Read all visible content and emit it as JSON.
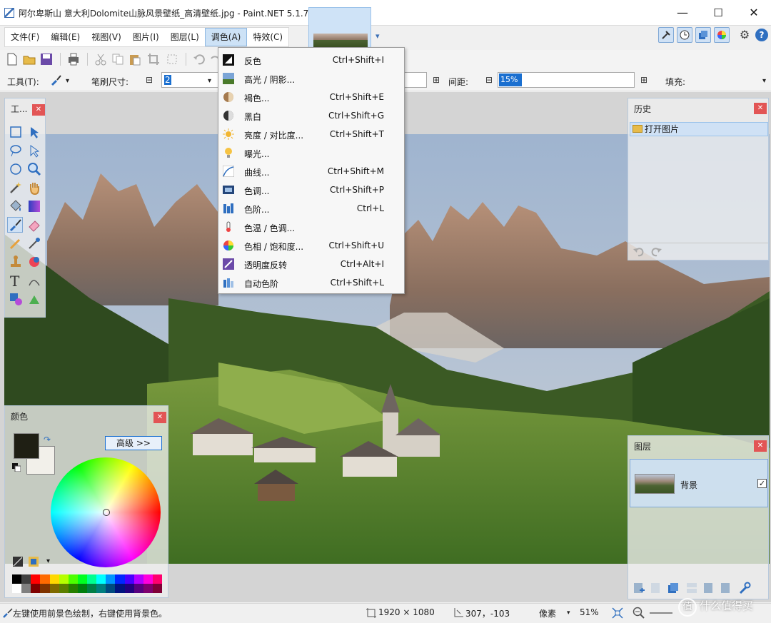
{
  "window": {
    "title": "阿尔卑斯山 意大利Dolomite山脉风景壁纸_高清壁纸.jpg - Paint.NET 5.1.7",
    "controls": {
      "minimize": "—",
      "maximize": "☐",
      "close": "✕"
    }
  },
  "menubar": {
    "items": [
      "文件(F)",
      "编辑(E)",
      "视图(V)",
      "图片(I)",
      "图层(L)",
      "调色(A)",
      "特效(C)"
    ],
    "active_index": 5
  },
  "tool_options": {
    "tool_label": "工具(T):",
    "brush_size_label": "笔刷尺寸:",
    "brush_size_value": "2",
    "gap_label": "间距:",
    "gap_value": "15%",
    "fill_label": "填充:"
  },
  "adjustments_menu": {
    "items": [
      {
        "label": "反色",
        "shortcut": "Ctrl+Shift+I",
        "icon": "invert-colors-icon"
      },
      {
        "label": "高光 / 阴影...",
        "shortcut": "",
        "icon": "highlights-shadows-icon"
      },
      {
        "label": "褐色...",
        "shortcut": "Ctrl+Shift+E",
        "icon": "sepia-icon"
      },
      {
        "label": "黑白",
        "shortcut": "Ctrl+Shift+G",
        "icon": "black-white-icon"
      },
      {
        "label": "亮度 / 对比度...",
        "shortcut": "Ctrl+Shift+T",
        "icon": "brightness-contrast-icon"
      },
      {
        "label": "曝光...",
        "shortcut": "",
        "icon": "exposure-icon"
      },
      {
        "label": "曲线...",
        "shortcut": "Ctrl+Shift+M",
        "icon": "curves-icon"
      },
      {
        "label": "色调...",
        "shortcut": "Ctrl+Shift+P",
        "icon": "posterize-icon"
      },
      {
        "label": "色阶...",
        "shortcut": "Ctrl+L",
        "icon": "levels-icon"
      },
      {
        "label": "色温 / 色调...",
        "shortcut": "",
        "icon": "temperature-icon"
      },
      {
        "label": "色相 / 饱和度...",
        "shortcut": "Ctrl+Shift+U",
        "icon": "hue-saturation-icon"
      },
      {
        "label": "透明度反转",
        "shortcut": "Ctrl+Alt+I",
        "icon": "invert-alpha-icon"
      },
      {
        "label": "自动色阶",
        "shortcut": "Ctrl+Shift+L",
        "icon": "auto-level-icon"
      }
    ]
  },
  "tools_panel": {
    "title": "工..."
  },
  "history_panel": {
    "title": "历史",
    "items": [
      "打开图片"
    ]
  },
  "layers_panel": {
    "title": "图层",
    "layers": [
      {
        "name": "背景",
        "visible": true
      }
    ]
  },
  "colors_panel": {
    "title": "颜色",
    "more_button": "高级 >>",
    "primary_color": "#1f1f14",
    "secondary_color": "#f2f0ea"
  },
  "statusbar": {
    "hint": "左键使用前景色绘制，右键使用背景色。",
    "image_size": "1920 × 1080",
    "cursor_pos": "307，-103",
    "units": "像素",
    "zoom": "51%"
  },
  "watermark": {
    "badge": "值",
    "text": "什么值得买"
  }
}
